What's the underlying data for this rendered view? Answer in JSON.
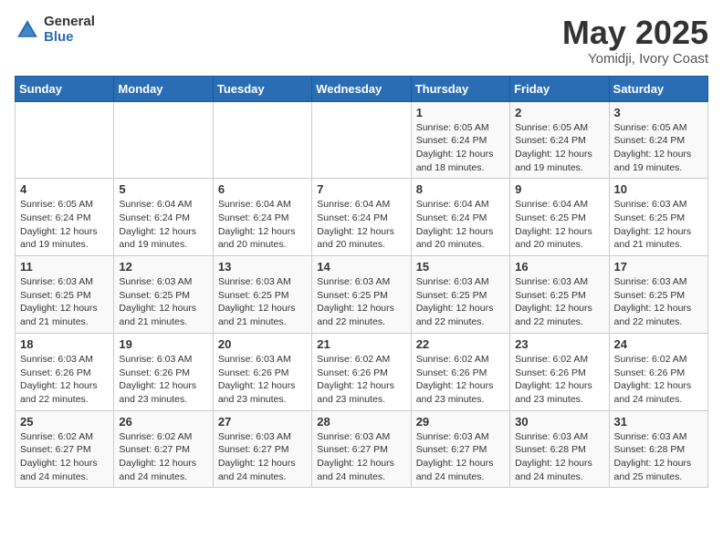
{
  "header": {
    "logo_general": "General",
    "logo_blue": "Blue",
    "title": "May 2025",
    "subtitle": "Yomidji, Ivory Coast"
  },
  "weekdays": [
    "Sunday",
    "Monday",
    "Tuesday",
    "Wednesday",
    "Thursday",
    "Friday",
    "Saturday"
  ],
  "weeks": [
    [
      {
        "day": "",
        "info": ""
      },
      {
        "day": "",
        "info": ""
      },
      {
        "day": "",
        "info": ""
      },
      {
        "day": "",
        "info": ""
      },
      {
        "day": "1",
        "info": "Sunrise: 6:05 AM\nSunset: 6:24 PM\nDaylight: 12 hours and 18 minutes."
      },
      {
        "day": "2",
        "info": "Sunrise: 6:05 AM\nSunset: 6:24 PM\nDaylight: 12 hours and 19 minutes."
      },
      {
        "day": "3",
        "info": "Sunrise: 6:05 AM\nSunset: 6:24 PM\nDaylight: 12 hours and 19 minutes."
      }
    ],
    [
      {
        "day": "4",
        "info": "Sunrise: 6:05 AM\nSunset: 6:24 PM\nDaylight: 12 hours and 19 minutes."
      },
      {
        "day": "5",
        "info": "Sunrise: 6:04 AM\nSunset: 6:24 PM\nDaylight: 12 hours and 19 minutes."
      },
      {
        "day": "6",
        "info": "Sunrise: 6:04 AM\nSunset: 6:24 PM\nDaylight: 12 hours and 20 minutes."
      },
      {
        "day": "7",
        "info": "Sunrise: 6:04 AM\nSunset: 6:24 PM\nDaylight: 12 hours and 20 minutes."
      },
      {
        "day": "8",
        "info": "Sunrise: 6:04 AM\nSunset: 6:24 PM\nDaylight: 12 hours and 20 minutes."
      },
      {
        "day": "9",
        "info": "Sunrise: 6:04 AM\nSunset: 6:25 PM\nDaylight: 12 hours and 20 minutes."
      },
      {
        "day": "10",
        "info": "Sunrise: 6:03 AM\nSunset: 6:25 PM\nDaylight: 12 hours and 21 minutes."
      }
    ],
    [
      {
        "day": "11",
        "info": "Sunrise: 6:03 AM\nSunset: 6:25 PM\nDaylight: 12 hours and 21 minutes."
      },
      {
        "day": "12",
        "info": "Sunrise: 6:03 AM\nSunset: 6:25 PM\nDaylight: 12 hours and 21 minutes."
      },
      {
        "day": "13",
        "info": "Sunrise: 6:03 AM\nSunset: 6:25 PM\nDaylight: 12 hours and 21 minutes."
      },
      {
        "day": "14",
        "info": "Sunrise: 6:03 AM\nSunset: 6:25 PM\nDaylight: 12 hours and 22 minutes."
      },
      {
        "day": "15",
        "info": "Sunrise: 6:03 AM\nSunset: 6:25 PM\nDaylight: 12 hours and 22 minutes."
      },
      {
        "day": "16",
        "info": "Sunrise: 6:03 AM\nSunset: 6:25 PM\nDaylight: 12 hours and 22 minutes."
      },
      {
        "day": "17",
        "info": "Sunrise: 6:03 AM\nSunset: 6:25 PM\nDaylight: 12 hours and 22 minutes."
      }
    ],
    [
      {
        "day": "18",
        "info": "Sunrise: 6:03 AM\nSunset: 6:26 PM\nDaylight: 12 hours and 22 minutes."
      },
      {
        "day": "19",
        "info": "Sunrise: 6:03 AM\nSunset: 6:26 PM\nDaylight: 12 hours and 23 minutes."
      },
      {
        "day": "20",
        "info": "Sunrise: 6:03 AM\nSunset: 6:26 PM\nDaylight: 12 hours and 23 minutes."
      },
      {
        "day": "21",
        "info": "Sunrise: 6:02 AM\nSunset: 6:26 PM\nDaylight: 12 hours and 23 minutes."
      },
      {
        "day": "22",
        "info": "Sunrise: 6:02 AM\nSunset: 6:26 PM\nDaylight: 12 hours and 23 minutes."
      },
      {
        "day": "23",
        "info": "Sunrise: 6:02 AM\nSunset: 6:26 PM\nDaylight: 12 hours and 23 minutes."
      },
      {
        "day": "24",
        "info": "Sunrise: 6:02 AM\nSunset: 6:26 PM\nDaylight: 12 hours and 24 minutes."
      }
    ],
    [
      {
        "day": "25",
        "info": "Sunrise: 6:02 AM\nSunset: 6:27 PM\nDaylight: 12 hours and 24 minutes."
      },
      {
        "day": "26",
        "info": "Sunrise: 6:02 AM\nSunset: 6:27 PM\nDaylight: 12 hours and 24 minutes."
      },
      {
        "day": "27",
        "info": "Sunrise: 6:03 AM\nSunset: 6:27 PM\nDaylight: 12 hours and 24 minutes."
      },
      {
        "day": "28",
        "info": "Sunrise: 6:03 AM\nSunset: 6:27 PM\nDaylight: 12 hours and 24 minutes."
      },
      {
        "day": "29",
        "info": "Sunrise: 6:03 AM\nSunset: 6:27 PM\nDaylight: 12 hours and 24 minutes."
      },
      {
        "day": "30",
        "info": "Sunrise: 6:03 AM\nSunset: 6:28 PM\nDaylight: 12 hours and 24 minutes."
      },
      {
        "day": "31",
        "info": "Sunrise: 6:03 AM\nSunset: 6:28 PM\nDaylight: 12 hours and 25 minutes."
      }
    ]
  ]
}
